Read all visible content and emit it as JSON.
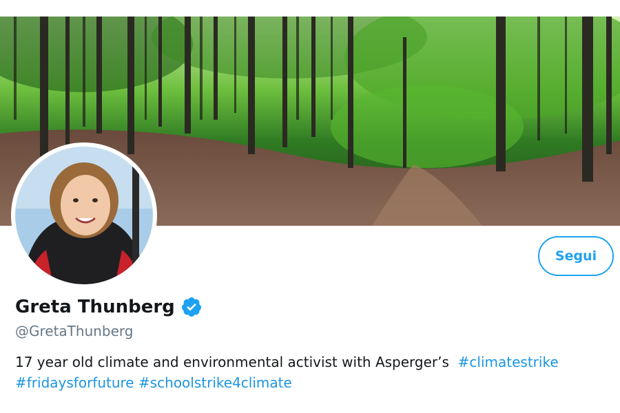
{
  "banner": {
    "description_icon": "forest-banner-image"
  },
  "avatar": {
    "icon": "profile-avatar-image"
  },
  "follow_button": {
    "label": "Segui"
  },
  "profile": {
    "display_name": "Greta Thunberg",
    "verified_icon": "verified-badge-icon",
    "handle": "@GretaThunberg",
    "bio_text": "17 year old climate and environmental activist with Asperger’s",
    "hashtags": [
      "#climatestrike",
      "#fridaysforfuture",
      "#schoolstrike4climate"
    ]
  },
  "colors": {
    "accent": "#1da1f2",
    "hashtag": "#1b95e0",
    "name": "#14171a",
    "handle": "#657786"
  }
}
